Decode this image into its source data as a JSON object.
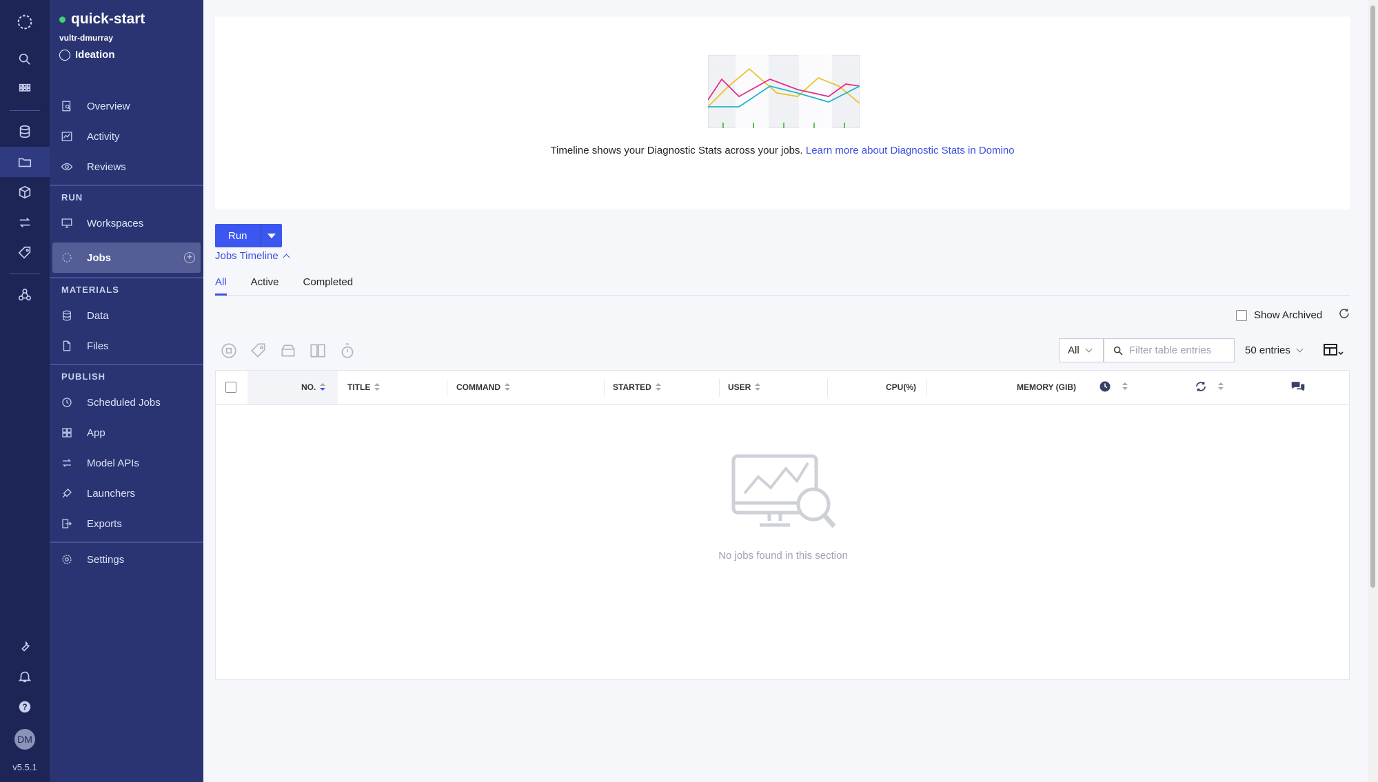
{
  "project": {
    "name": "quick-start",
    "owner": "vultr-dmurray",
    "stage": "Ideation"
  },
  "nav": {
    "top": [
      {
        "label": "Overview",
        "icon": "overview-icon"
      },
      {
        "label": "Activity",
        "icon": "activity-icon"
      },
      {
        "label": "Reviews",
        "icon": "eye-icon"
      }
    ],
    "run_section": "RUN",
    "run": [
      {
        "label": "Workspaces",
        "icon": "monitor-icon"
      },
      {
        "label": "Jobs",
        "icon": "jobs-icon",
        "active": true
      }
    ],
    "materials_section": "MATERIALS",
    "materials": [
      {
        "label": "Data",
        "icon": "database-icon"
      },
      {
        "label": "Files",
        "icon": "file-icon"
      }
    ],
    "publish_section": "PUBLISH",
    "publish": [
      {
        "label": "Scheduled Jobs",
        "icon": "clock-icon"
      },
      {
        "label": "App",
        "icon": "app-icon"
      },
      {
        "label": "Model APIs",
        "icon": "swap-icon"
      },
      {
        "label": "Launchers",
        "icon": "launcher-icon"
      },
      {
        "label": "Exports",
        "icon": "export-icon"
      }
    ],
    "settings": {
      "label": "Settings",
      "icon": "gear-icon"
    }
  },
  "rail": {
    "avatar": "DM",
    "version": "v5.5.1"
  },
  "timeline": {
    "text": "Timeline shows your Diagnostic Stats across your jobs.",
    "link": "Learn more about Diagnostic Stats in Domino",
    "toggle_label": "Jobs Timeline"
  },
  "run_button": {
    "label": "Run"
  },
  "tabs": [
    {
      "label": "All",
      "active": true
    },
    {
      "label": "Active"
    },
    {
      "label": "Completed"
    }
  ],
  "show_archived": {
    "label": "Show Archived",
    "checked": false
  },
  "filter": {
    "scope": "All",
    "placeholder": "Filter table entries",
    "entries": "50 entries"
  },
  "table": {
    "columns": [
      "NO.",
      "TITLE",
      "COMMAND",
      "STARTED",
      "USER",
      "CPU(%)",
      "MEMORY (GIB)"
    ],
    "empty_text": "No jobs found in this section"
  },
  "colors": {
    "rail": "#1d2557",
    "nav": "#2a3472",
    "accent": "#3b57f0",
    "link": "#3b4ee0",
    "status": "#3ed07a"
  }
}
